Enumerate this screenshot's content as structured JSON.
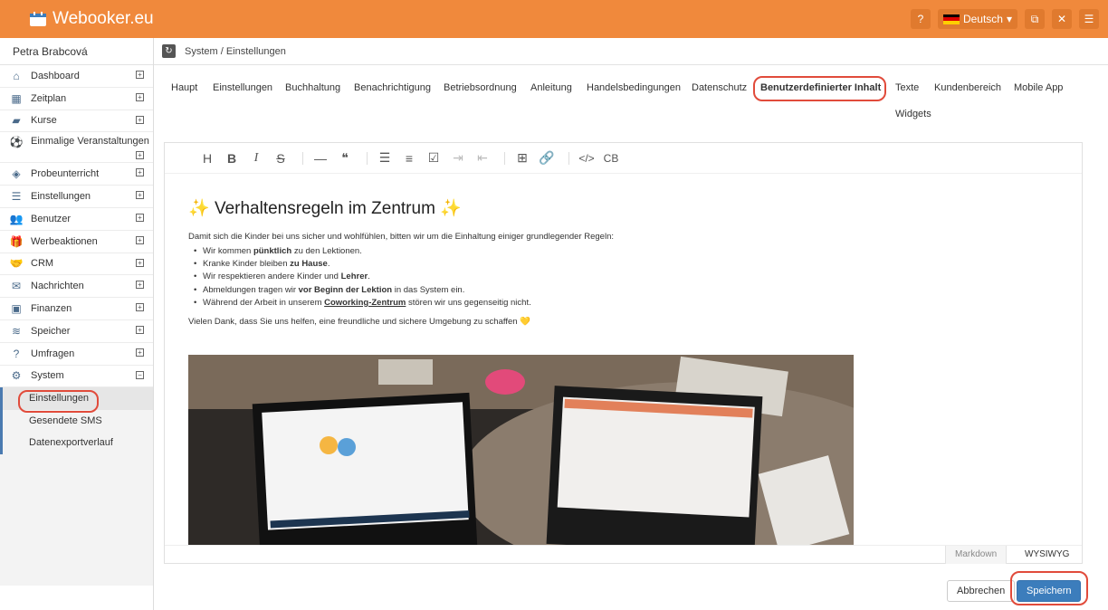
{
  "app": {
    "brand": "Webooker.eu",
    "language": "Deutsch"
  },
  "user": {
    "name": "Petra Brabcová"
  },
  "breadcrumb": "System / Einstellungen",
  "sidebar": {
    "items": [
      {
        "label": "Dashboard",
        "icon": "home-icon"
      },
      {
        "label": "Zeitplan",
        "icon": "calendar-icon"
      },
      {
        "label": "Kurse",
        "icon": "book-icon"
      },
      {
        "label": "Einmalige Veranstaltungen",
        "icon": "ball-icon"
      },
      {
        "label": "Probeunterricht",
        "icon": "eye-icon"
      },
      {
        "label": "Einstellungen",
        "icon": "sliders-icon"
      },
      {
        "label": "Benutzer",
        "icon": "users-icon"
      },
      {
        "label": "Werbeaktionen",
        "icon": "gift-icon"
      },
      {
        "label": "CRM",
        "icon": "handshake-icon"
      },
      {
        "label": "Nachrichten",
        "icon": "envelope-icon"
      },
      {
        "label": "Finanzen",
        "icon": "money-icon"
      },
      {
        "label": "Speicher",
        "icon": "database-icon"
      },
      {
        "label": "Umfragen",
        "icon": "question-icon"
      },
      {
        "label": "System",
        "icon": "cogs-icon"
      }
    ],
    "submenu": [
      "Einstellungen",
      "Gesendete SMS",
      "Datenexportverlauf"
    ]
  },
  "tabs": [
    "Haupt",
    "Einstellungen",
    "Buchhaltung",
    "Benachrichtigung",
    "Betriebsordnung",
    "Anleitung",
    "Handelsbedingungen",
    "Datenschutz",
    "Benutzerdefinierter Inhalt",
    "Texte",
    "Kundenbereich",
    "Mobile App",
    "Widgets"
  ],
  "toolbar": {
    "custom_block": "CB"
  },
  "content": {
    "heading": "Verhaltensregeln im Zentrum",
    "intro": "Damit sich die Kinder bei uns sicher und wohlfühlen, bitten wir um die Einhaltung einiger grundlegender Regeln:",
    "rules": [
      {
        "pre": "Wir kommen ",
        "bold": "pünktlich",
        "post": " zu den Lektionen."
      },
      {
        "pre": "Kranke Kinder bleiben ",
        "bold": "zu Hause",
        "post": "."
      },
      {
        "pre": "Wir respektieren andere Kinder und ",
        "bold": "Lehrer",
        "post": "."
      },
      {
        "pre": "Abmeldungen tragen wir ",
        "bold": "vor Beginn der Lektion",
        "post": " in das System ein."
      },
      {
        "pre": "Während der Arbeit in unserem ",
        "bold": "Coworking-Zentrum",
        "post": " stören wir uns gegenseitig nicht."
      }
    ],
    "thanks": "Vielen Dank, dass Sie uns helfen, eine freundliche und sichere Umgebung zu schaffen 💛"
  },
  "modes": {
    "markdown": "Markdown",
    "wysiwyg": "WYSIWYG"
  },
  "buttons": {
    "cancel": "Abbrechen",
    "save": "Speichern"
  },
  "colors": {
    "topbar": "#f0893c",
    "primary": "#3c7dbc",
    "highlight": "#e14b3b"
  }
}
